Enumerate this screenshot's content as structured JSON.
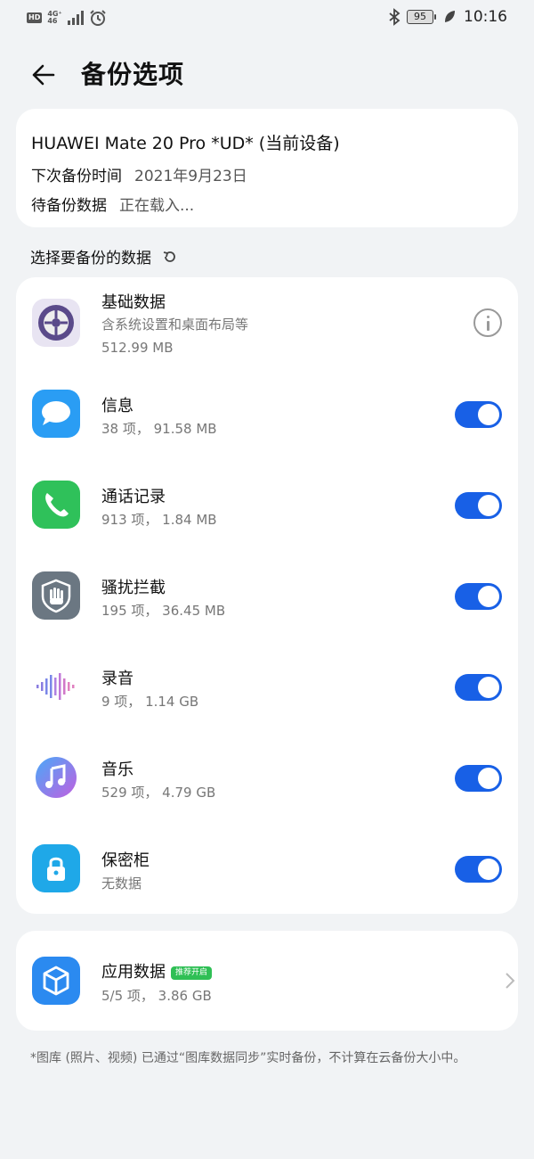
{
  "status_bar": {
    "hd": "HD",
    "net_top": "4G⁺",
    "net_bottom": "46",
    "battery": "95",
    "time": "10:16"
  },
  "header": {
    "title": "备份选项"
  },
  "device": {
    "name": "HUAWEI Mate 20 Pro *UD* (当前设备)",
    "next_backup_label": "下次备份时间",
    "next_backup_value": "2021年9月23日",
    "pending_label": "待备份数据",
    "pending_value": "正在载入..."
  },
  "section": {
    "title": "选择要备份的数据"
  },
  "items": [
    {
      "title": "基础数据",
      "sub1": "含系统设置和桌面布局等",
      "sub2": "512.99 MB",
      "icon": "settings-gear-icon",
      "control": "info"
    },
    {
      "title": "信息",
      "sub1": "38 项， 91.58 MB",
      "icon": "message-bubble-icon",
      "control": "toggle",
      "enabled": true
    },
    {
      "title": "通话记录",
      "sub1": "913 项， 1.84 MB",
      "icon": "phone-icon",
      "control": "toggle",
      "enabled": true
    },
    {
      "title": "骚扰拦截",
      "sub1": "195 项， 36.45 MB",
      "icon": "hand-block-icon",
      "control": "toggle",
      "enabled": true
    },
    {
      "title": "录音",
      "sub1": "9 项， 1.14 GB",
      "icon": "sound-wave-icon",
      "control": "toggle",
      "enabled": true
    },
    {
      "title": "音乐",
      "sub1": "529 项， 4.79 GB",
      "icon": "music-note-icon",
      "control": "toggle",
      "enabled": true
    },
    {
      "title": "保密柜",
      "sub1": "无数据",
      "icon": "lock-icon",
      "control": "toggle",
      "enabled": true
    }
  ],
  "app_data": {
    "title": "应用数据",
    "badge": "推荐开启",
    "sub": "5/5 项， 3.86 GB",
    "icon": "cube-icon"
  },
  "footnote": "*图库 (照片、视频) 已通过“图库数据同步”实时备份，不计算在云备份大小中。",
  "colors": {
    "accent": "#1860e6",
    "background": "#f1f3f5",
    "badge_green": "#2fbf55"
  }
}
